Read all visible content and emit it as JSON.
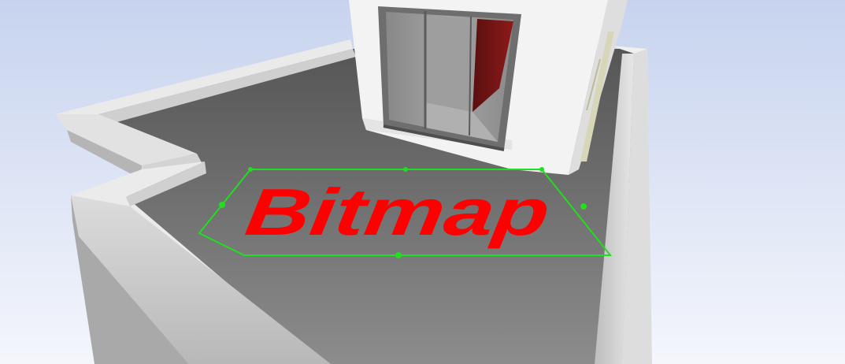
{
  "scene": {
    "bitmap": {
      "label": "Bitmap",
      "color": "#ff0000"
    },
    "colors": {
      "sky_top": "#c7d3ee",
      "sky_bottom": "#f4f6fc",
      "floor_light": "#8c8c8c",
      "floor_dark": "#565656",
      "wall_top": "#eeeeee",
      "wall_side": "#c6c6c6",
      "house_wall": "#f3f3f3",
      "window_frame": "#6e6e6e",
      "window_glass": "#9a9a9a",
      "curtain": "#7a1616",
      "selection": "#22dd22",
      "column": "#d8d6b8"
    }
  }
}
